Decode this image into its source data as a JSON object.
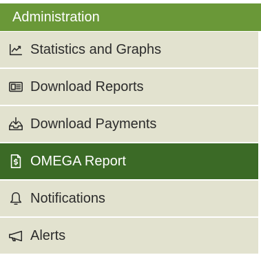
{
  "panel": {
    "title": "Administration"
  },
  "menu": {
    "items": [
      {
        "label": "Statistics and Graphs",
        "icon": "chart-line-icon"
      },
      {
        "label": "Download Reports",
        "icon": "report-icon"
      },
      {
        "label": "Download Payments",
        "icon": "tray-download-icon"
      },
      {
        "label": "OMEGA Report",
        "icon": "dollar-document-icon",
        "active": true
      },
      {
        "label": "Notifications",
        "icon": "bell-icon"
      },
      {
        "label": "Alerts",
        "icon": "megaphone-icon"
      }
    ]
  },
  "colors": {
    "header_bg": "#6a9838",
    "active_bg": "#3b6a26",
    "item_bg": "#e2e2cf"
  }
}
